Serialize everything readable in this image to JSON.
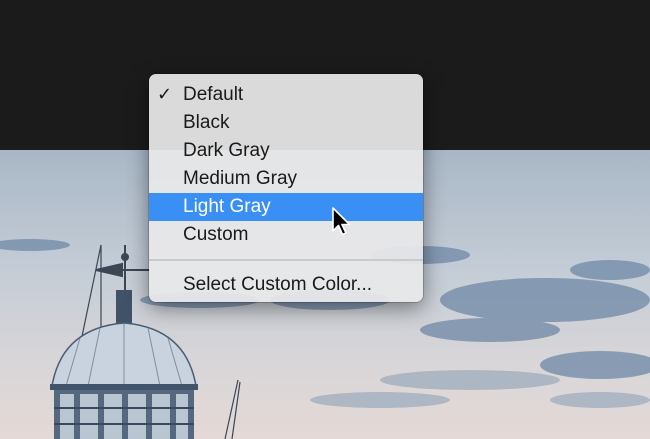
{
  "menu": {
    "items": [
      {
        "label": "Default",
        "checked": true
      },
      {
        "label": "Black"
      },
      {
        "label": "Dark Gray"
      },
      {
        "label": "Medium Gray"
      },
      {
        "label": "Light Gray",
        "highlighted": true
      },
      {
        "label": "Custom"
      }
    ],
    "action": {
      "label": "Select Custom Color..."
    },
    "checkmark": "✓",
    "highlight_color": "#3a8ff5"
  },
  "background": {
    "top_color": "#1b1b1b",
    "photo_subject": "lighthouse-with-weathervane"
  },
  "cursor": {
    "icon": "arrow-pointer-icon"
  }
}
